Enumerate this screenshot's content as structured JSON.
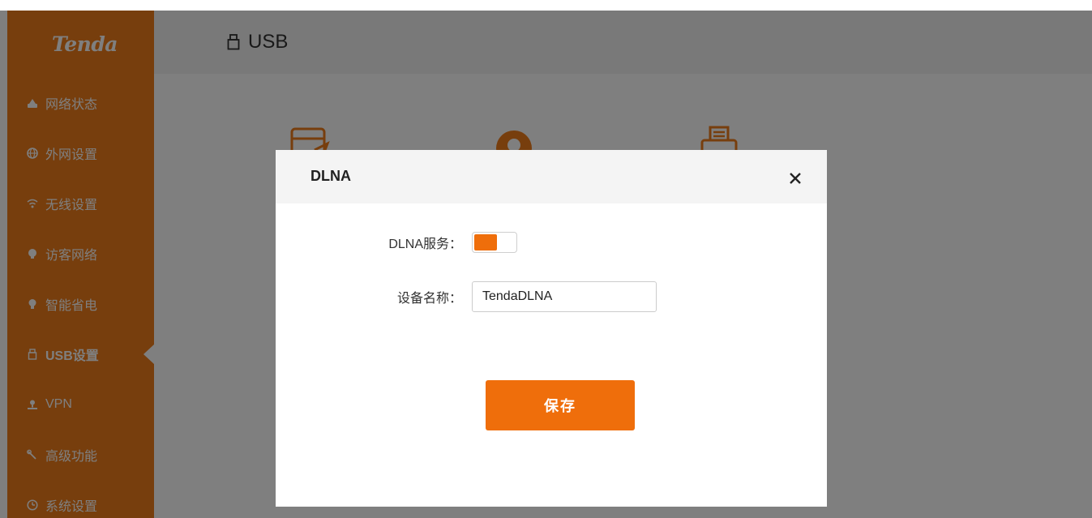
{
  "brand": {
    "logo": "Tenda",
    "accent": "#ef7d1a",
    "button": "#ef6e0b"
  },
  "sidebar": {
    "items": [
      {
        "label": "网络状态",
        "icon": "network-status-icon",
        "active": false
      },
      {
        "label": "外网设置",
        "icon": "globe-icon",
        "active": false
      },
      {
        "label": "无线设置",
        "icon": "wifi-icon",
        "active": false
      },
      {
        "label": "访客网络",
        "icon": "guest-icon",
        "active": false
      },
      {
        "label": "智能省电",
        "icon": "bulb-icon",
        "active": false
      },
      {
        "label": "USB设置",
        "icon": "usb-icon",
        "active": true
      },
      {
        "label": "VPN",
        "icon": "vpn-icon",
        "active": false
      },
      {
        "label": "高级功能",
        "icon": "wrench-icon",
        "active": false
      },
      {
        "label": "系统设置",
        "icon": "system-icon",
        "active": false
      }
    ]
  },
  "header": {
    "title": "USB",
    "icon": "usb-icon"
  },
  "background_icons": [
    "file-share-icon",
    "dlna-icon",
    "printer-icon"
  ],
  "modal": {
    "title": "DLNA",
    "close_icon": "close-icon",
    "dlna_service": {
      "label": "DLNA服务：",
      "enabled": true
    },
    "device_name": {
      "label": "设备名称：",
      "value": "TendaDLNA"
    },
    "save_label": "保存"
  }
}
